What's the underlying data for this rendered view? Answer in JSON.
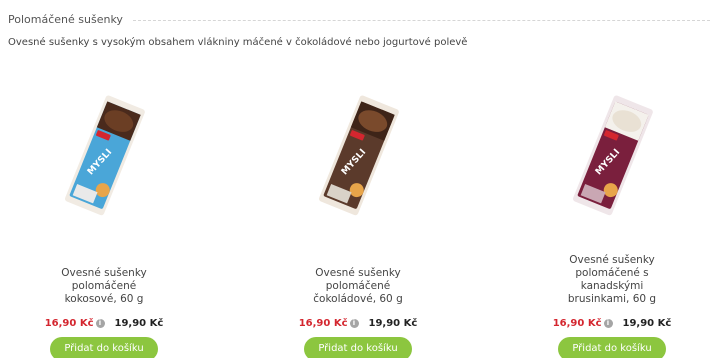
{
  "section": {
    "title": "Polomáčené sušenky",
    "description": "Ovesné sušenky s vysokým obsahem vlákniny máčené v čokoládové nebo jogurtové polevě"
  },
  "products": [
    {
      "name": "Ovesné sušenky polomáčené kokosové, 60 g",
      "sale_price": "16,90 Kč",
      "regular_price": "19,90 Kč",
      "button_label": "Přidat do košíku",
      "package_color": "#4aa6d8",
      "package_text": "MYSLI"
    },
    {
      "name": "Ovesné sušenky polomáčené čokoládové, 60 g",
      "sale_price": "16,90 Kč",
      "regular_price": "19,90 Kč",
      "button_label": "Přidat do košíku",
      "package_color": "#5b3a2b",
      "package_text": "MYSLI"
    },
    {
      "name": "Ovesné sušenky polomáčené s kanadskými brusinkami, 60 g",
      "sale_price": "16,90 Kč",
      "regular_price": "19,90 Kč",
      "button_label": "Přidat do košíku",
      "package_color": "#7a1f3d",
      "package_text": "MYSLI"
    }
  ],
  "colors": {
    "accent_green": "#8cc63f",
    "sale_red": "#d4262f"
  },
  "icons": {
    "info": "info-icon"
  }
}
